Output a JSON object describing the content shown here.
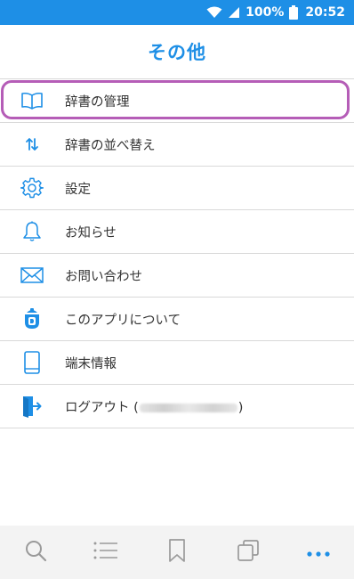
{
  "status_bar": {
    "battery": "100%",
    "time": "20:52",
    "icons": [
      "wifi-icon",
      "signal-icon",
      "battery-icon"
    ]
  },
  "header": {
    "title": "その他"
  },
  "menu": {
    "items": [
      {
        "label": "辞書の管理",
        "icon": "book-icon",
        "highlighted": true
      },
      {
        "label": "辞書の並べ替え",
        "icon": "sort-arrows-icon"
      },
      {
        "label": "設定",
        "icon": "gear-icon"
      },
      {
        "label": "お知らせ",
        "icon": "bell-icon"
      },
      {
        "label": "お問い合わせ",
        "icon": "mail-icon"
      },
      {
        "label": "このアプリについて",
        "icon": "app-logo-icon"
      },
      {
        "label": "端末情報",
        "icon": "smartphone-icon"
      },
      {
        "label_prefix": "ログアウト (",
        "label_suffix": ")",
        "icon": "logout-icon"
      }
    ]
  },
  "bottom_nav": {
    "items": [
      {
        "icon": "search-icon"
      },
      {
        "icon": "list-icon"
      },
      {
        "icon": "bookmark-icon"
      },
      {
        "icon": "copy-icon"
      },
      {
        "icon": "more-icon",
        "active": true
      }
    ]
  },
  "colors": {
    "accent": "#1e8fe6",
    "highlight": "#b55db7",
    "text": "#333333",
    "divider": "#d9d9d9",
    "nav_background": "#f3f3f3",
    "nav_icon": "#9a9a9a"
  }
}
